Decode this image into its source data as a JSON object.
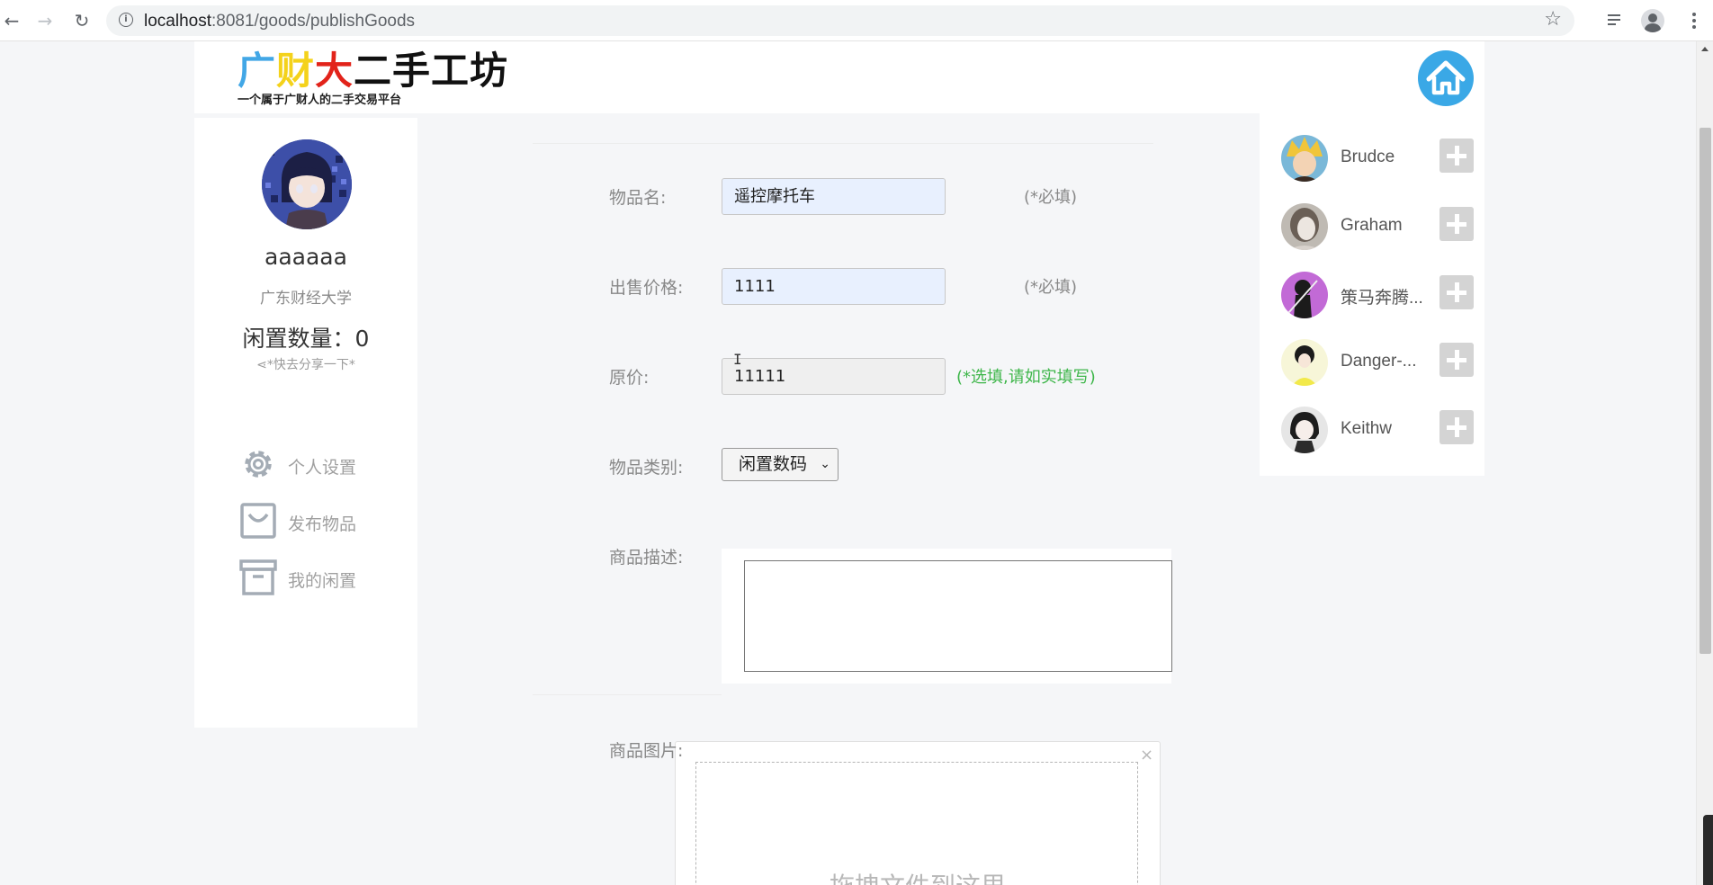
{
  "browser": {
    "url_host": "localhost",
    "url_path": ":8081/goods/publishGoods"
  },
  "site": {
    "logo_part1": "广",
    "logo_part2": "财",
    "logo_part3": "大",
    "logo_part4": "二手工坊",
    "logo_subtitle": "一个属于广财人的二手交易平台",
    "colors": {
      "blue": "#42a7e6",
      "yellow": "#f4d21b",
      "red": "#e2231a",
      "home": "#3aa8e6"
    }
  },
  "profile": {
    "username": "aaaaaa",
    "school": "广东财经大学",
    "idle_count": "闲置数量：0",
    "share": "*快去分享一下*"
  },
  "menu": {
    "settings": "个人设置",
    "publish": "发布物品",
    "my_idle": "我的闲置"
  },
  "form": {
    "name_label": "物品名:",
    "name_value": "遥控摩托车",
    "required_hint": "(*必填)",
    "price_label": "出售价格:",
    "price_value": "1111",
    "orig_label": "原价:",
    "orig_value": "11111",
    "orig_hint": "(*选填,请如实填写)",
    "category_label": "物品类别:",
    "category_value": "闲置数码",
    "desc_label": "商品描述:",
    "image_label": "商品图片:",
    "upload_text": "拖拽文件到这里",
    "upload_close": "×"
  },
  "friends": [
    {
      "name": "Brudce"
    },
    {
      "name": "Graham"
    },
    {
      "name": "策马奔腾..."
    },
    {
      "name": "Danger-..."
    },
    {
      "name": "Keithw"
    }
  ]
}
